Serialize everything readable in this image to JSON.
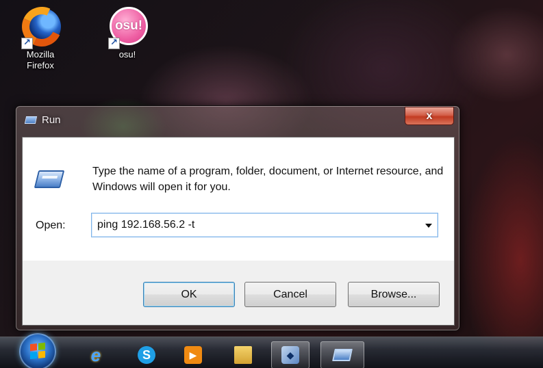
{
  "desktop": {
    "icons": [
      {
        "label_line1": "Mozilla",
        "label_line2": "Firefox",
        "icon": "firefox-icon"
      },
      {
        "label_line1": "osu!",
        "label_line2": "",
        "icon": "osu-icon",
        "badge_text": "osu!"
      }
    ]
  },
  "dialog": {
    "title": "Run",
    "close_glyph": "x",
    "description": "Type the name of a program, folder, document, or Internet resource, and Windows will open it for you.",
    "open_label": "Open:",
    "open_value": "ping 192.168.56.2 -t",
    "buttons": {
      "ok": "OK",
      "cancel": "Cancel",
      "browse": "Browse..."
    }
  },
  "taskbar": {
    "items": [
      {
        "icon": "internet-explorer-icon",
        "glyph": "e"
      },
      {
        "icon": "skype-icon",
        "glyph": "S"
      },
      {
        "icon": "media-player-icon",
        "glyph": "▶"
      },
      {
        "icon": "windows-explorer-icon",
        "glyph": ""
      },
      {
        "icon": "virtualbox-icon",
        "glyph": "◆"
      },
      {
        "icon": "run-icon",
        "glyph": "",
        "active": true
      }
    ]
  },
  "colors": {
    "close_button": "#c23b22",
    "input_focus_border": "#7eb4ea",
    "default_button_border": "#3c7fb1"
  }
}
